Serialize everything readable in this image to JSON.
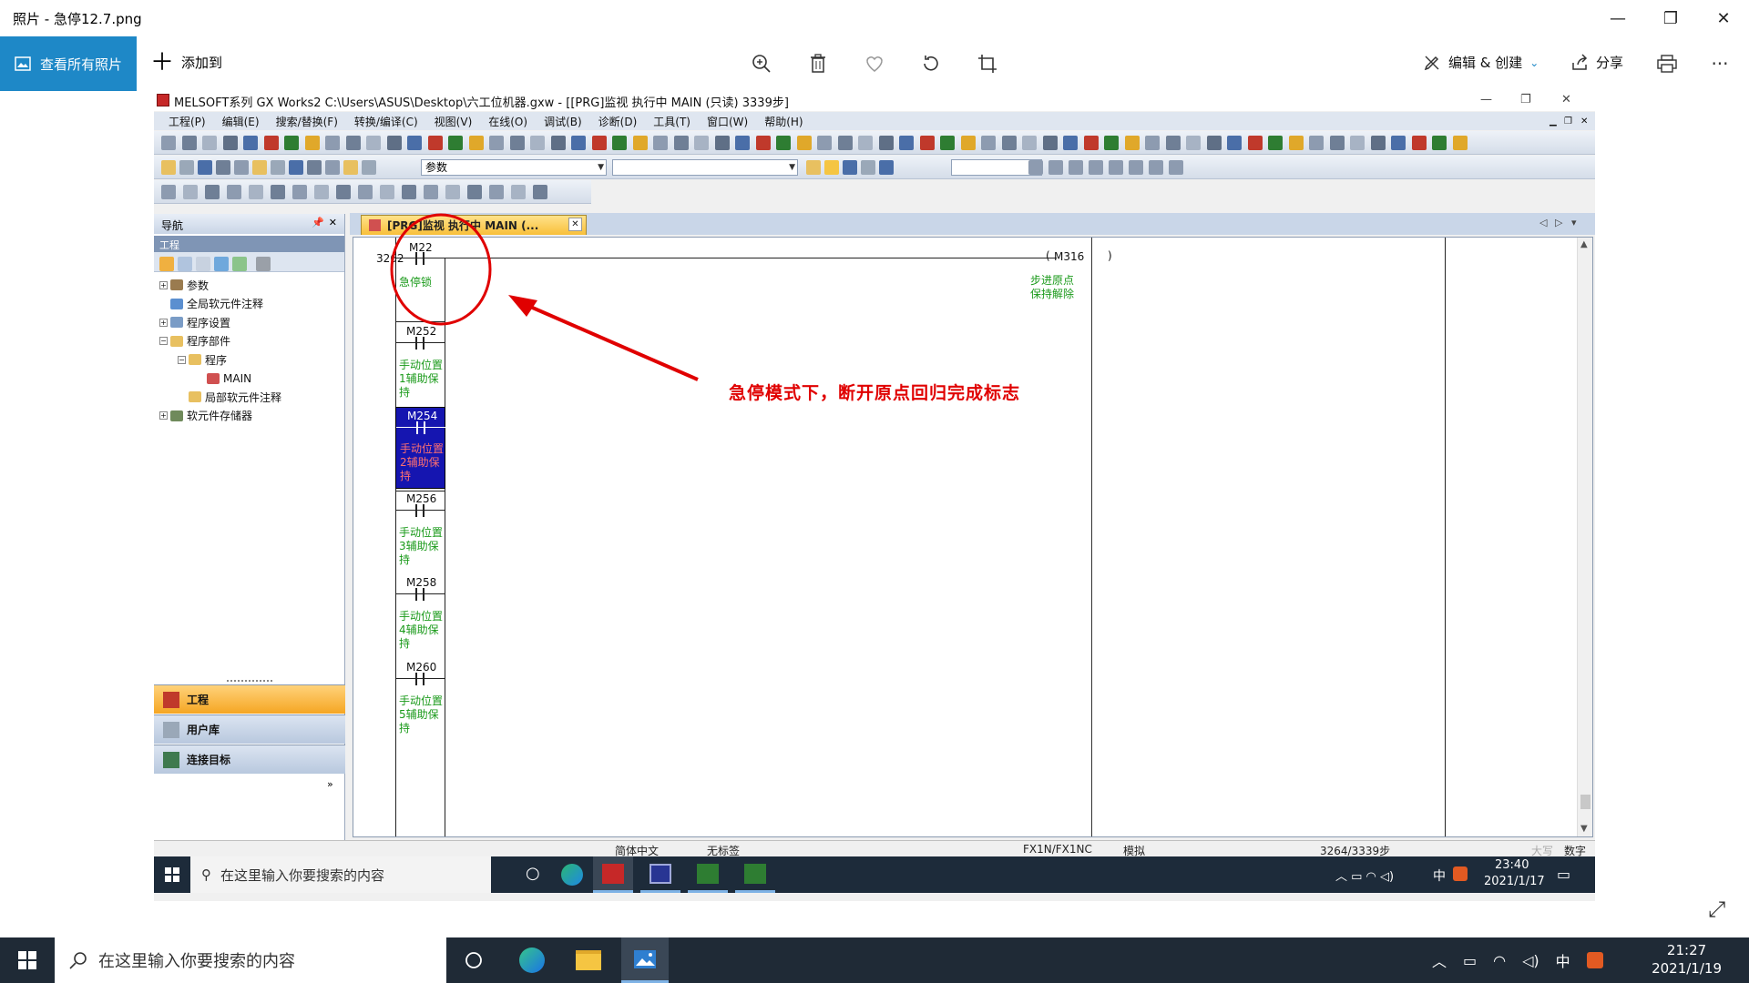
{
  "photos": {
    "title": "照片 - 急停12.7.png",
    "view_all": "查看所有照片",
    "add_to": "添加到",
    "edit_create": "编辑 & 创建",
    "share": "分享"
  },
  "gx": {
    "title": "MELSOFT系列 GX Works2 C:\\Users\\ASUS\\Desktop\\六工位机器.gxw - [[PRG]监视 执行中 MAIN (只读) 3339步]",
    "menu": [
      "工程(P)",
      "编辑(E)",
      "搜索/替换(F)",
      "转换/编译(C)",
      "视图(V)",
      "在线(O)",
      "调试(B)",
      "诊断(D)",
      "工具(T)",
      "窗口(W)",
      "帮助(H)"
    ],
    "combo_param": "参数",
    "nav": {
      "title": "导航",
      "sub": "工程",
      "tree": [
        {
          "label": "参数",
          "indent": 0,
          "exp": "+"
        },
        {
          "label": "全局软元件注释",
          "indent": 0,
          "exp": ""
        },
        {
          "label": "程序设置",
          "indent": 0,
          "exp": "+"
        },
        {
          "label": "程序部件",
          "indent": 0,
          "exp": "-"
        },
        {
          "label": "程序",
          "indent": 1,
          "exp": "-"
        },
        {
          "label": "MAIN",
          "indent": 2,
          "exp": ""
        },
        {
          "label": "局部软元件注释",
          "indent": 1,
          "exp": ""
        },
        {
          "label": "软元件存储器",
          "indent": 0,
          "exp": "+"
        }
      ],
      "buttons": [
        "工程",
        "用户库",
        "连接目标"
      ]
    },
    "tab_label": "[PRG]监视 执行中 MAIN (...",
    "ladder": {
      "step": "3262",
      "output": "M316",
      "output_comment": [
        "步进原点",
        "保持解除"
      ],
      "contacts": [
        {
          "name": "M22",
          "comment": [
            "急停锁"
          ]
        },
        {
          "name": "M252",
          "comment": [
            "手动位置",
            "1辅助保持"
          ]
        },
        {
          "name": "M254",
          "comment": [
            "手动位置",
            "2辅助保持"
          ],
          "selected": true
        },
        {
          "name": "M256",
          "comment": [
            "手动位置",
            "3辅助保持"
          ]
        },
        {
          "name": "M258",
          "comment": [
            "手动位置",
            "4辅助保持"
          ]
        },
        {
          "name": "M260",
          "comment": [
            "手动位置",
            "5辅助保持"
          ]
        }
      ]
    },
    "status": {
      "lang": "简体中文",
      "label": "无标签",
      "cpu": "FX1N/FX1NC",
      "mode": "模拟",
      "steps": "3264/3339步",
      "caps": "大写",
      "num": "数字"
    },
    "inner_taskbar": {
      "search": "在这里输入你要搜索的内容",
      "time": "23:40",
      "date": "2021/1/17",
      "ime": "中"
    }
  },
  "annotation": "急停模式下，断开原点回归完成标志",
  "taskbar": {
    "search": "在这里输入你要搜索的内容",
    "ime": "中",
    "time": "21:27",
    "date": "2021/1/19"
  },
  "colors": {
    "accent": "#1e88c7",
    "annotation": "#e00000",
    "comment": "#1a9a1a",
    "selected": "#1515b0"
  }
}
